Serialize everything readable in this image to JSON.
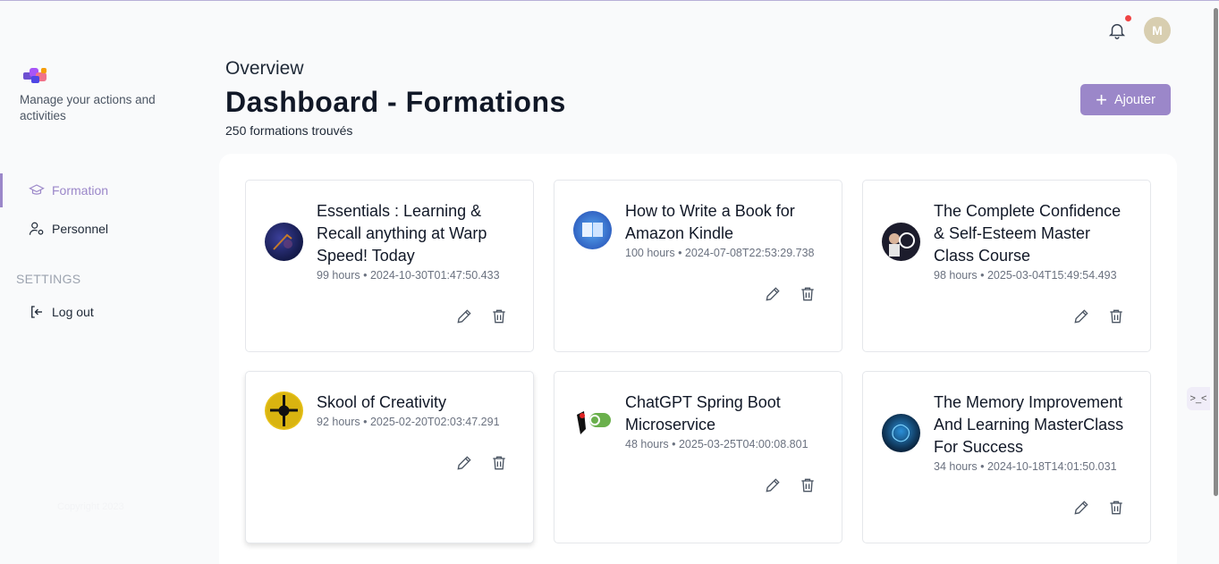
{
  "sidebar": {
    "tagline": "Manage your actions and activities",
    "nav": [
      {
        "label": "Formation",
        "icon": "graduation-cap-icon",
        "active": true
      },
      {
        "label": "Personnel",
        "icon": "user-gear-icon",
        "active": false
      }
    ],
    "settings_label": "SETTINGS",
    "logout_label": "Log out",
    "copyright": "Copyright 2023"
  },
  "topbar": {
    "avatar_initial": "M",
    "notification_dot": true
  },
  "header": {
    "overview": "Overview",
    "title": "Dashboard - Formations",
    "count": "250 formations trouvés",
    "add_label": "Ajouter"
  },
  "cards": [
    {
      "title": "Essentials : Learning & Recall anything at Warp Speed! Today",
      "meta": "99 hours • 2024-10-30T01:47:50.433"
    },
    {
      "title": "How to Write a Book for Amazon Kindle",
      "meta": "100 hours • 2024-07-08T22:53:29.738"
    },
    {
      "title": "The Complete Confidence & Self-Esteem Master Class Course",
      "meta": "98 hours • 2025-03-04T15:49:54.493"
    },
    {
      "title": "Skool of Creativity",
      "meta": "92 hours • 2025-02-20T02:03:47.291"
    },
    {
      "title": "ChatGPT Spring Boot Microservice",
      "meta": "48 hours • 2025-03-25T04:00:08.801"
    },
    {
      "title": "The Memory Improvement And Learning MasterClass For Success",
      "meta": "34 hours • 2024-10-18T14:01:50.031"
    }
  ],
  "colors": {
    "accent": "#9b87c9",
    "notification": "#ef4444"
  }
}
